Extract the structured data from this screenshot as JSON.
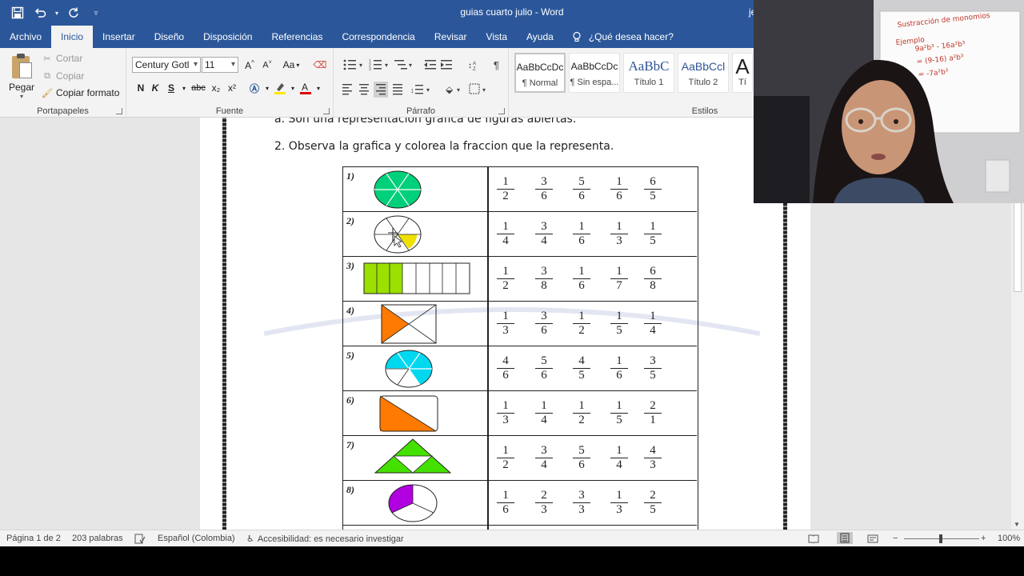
{
  "window": {
    "doc_title": "guias cuarto julio  -  Word",
    "user_fragment": "je"
  },
  "tabs": [
    "Archivo",
    "Inicio",
    "Insertar",
    "Diseño",
    "Disposición",
    "Referencias",
    "Correspondencia",
    "Revisar",
    "Vista",
    "Ayuda"
  ],
  "tell_me": "¿Qué desea hacer?",
  "clipboard": {
    "paste": "Pegar",
    "cut": "Cortar",
    "copy": "Copiar",
    "format_painter": "Copiar formato",
    "label": "Portapapeles"
  },
  "font": {
    "name": "Century Gotl",
    "size": "11",
    "label": "Fuente",
    "bold": "N",
    "italic": "K",
    "underline": "S",
    "strike": "abc",
    "subscript": "x₂",
    "superscript": "x²",
    "grow": "A^",
    "shrink": "A˅",
    "case": "Aa"
  },
  "paragraph": {
    "label": "Párrafo"
  },
  "styles": {
    "label": "Estilos",
    "items": [
      {
        "preview": "AaBbCcDc",
        "name": "¶ Normal"
      },
      {
        "preview": "AaBbCcDc",
        "name": "¶ Sin espa..."
      },
      {
        "preview": "AaBbC",
        "name": "Título 1"
      },
      {
        "preview": "AaBbCcl",
        "name": "Título 2"
      },
      {
        "preview": "A",
        "name": "Tí"
      }
    ]
  },
  "document": {
    "line_a": "a.   Son una representación gráfica de figuras abiertas.",
    "line_2": "2.   Observa la grafica y colorea la fraccion que la representa."
  },
  "worksheet": {
    "rows": [
      {
        "num": "1)",
        "fractions": [
          [
            "1",
            "2"
          ],
          [
            "3",
            "6"
          ],
          [
            "5",
            "6"
          ],
          [
            "1",
            "6"
          ],
          [
            "6",
            "5"
          ]
        ]
      },
      {
        "num": "2)",
        "fractions": [
          [
            "1",
            "4"
          ],
          [
            "3",
            "4"
          ],
          [
            "1",
            "6"
          ],
          [
            "1",
            "3"
          ],
          [
            "1",
            "5"
          ]
        ]
      },
      {
        "num": "3)",
        "fractions": [
          [
            "1",
            "2"
          ],
          [
            "3",
            "8"
          ],
          [
            "1",
            "6"
          ],
          [
            "1",
            "7"
          ],
          [
            "6",
            "8"
          ]
        ]
      },
      {
        "num": "4)",
        "fractions": [
          [
            "1",
            "3"
          ],
          [
            "3",
            "6"
          ],
          [
            "1",
            "2"
          ],
          [
            "1",
            "5"
          ],
          [
            "1",
            "4"
          ]
        ]
      },
      {
        "num": "5)",
        "fractions": [
          [
            "4",
            "6"
          ],
          [
            "5",
            "6"
          ],
          [
            "4",
            "5"
          ],
          [
            "1",
            "6"
          ],
          [
            "3",
            "5"
          ]
        ]
      },
      {
        "num": "6)",
        "fractions": [
          [
            "1",
            "3"
          ],
          [
            "1",
            "4"
          ],
          [
            "1",
            "2"
          ],
          [
            "1",
            "5"
          ],
          [
            "2",
            "1"
          ]
        ]
      },
      {
        "num": "7)",
        "fractions": [
          [
            "1",
            "2"
          ],
          [
            "3",
            "4"
          ],
          [
            "5",
            "6"
          ],
          [
            "1",
            "4"
          ],
          [
            "4",
            "3"
          ]
        ]
      },
      {
        "num": "8)",
        "fractions": [
          [
            "1",
            "6"
          ],
          [
            "2",
            "3"
          ],
          [
            "3",
            "3"
          ],
          [
            "1",
            "3"
          ],
          [
            "2",
            "5"
          ]
        ]
      }
    ],
    "colors": {
      "green": "#00d07a",
      "yellow": "#f0e000",
      "lime": "#9be000",
      "orange": "#ff7a00",
      "cyan": "#00d8f0",
      "bright_green": "#44e000",
      "purple": "#b000e0"
    }
  },
  "status": {
    "page": "Página 1 de 2",
    "words": "203 palabras",
    "language": "Español (Colombia)",
    "accessibility": "Accesibilidad: es necesario investigar",
    "zoom": "100%",
    "zoom_level": 1.0
  },
  "webcam": {
    "board_title": "Sustracción de monomios",
    "board_example": "Ejemplo",
    "board_line1": "9a²b³ - 16a²b³",
    "board_line2": "= (9-16) a²b³",
    "board_line3": "= -7a²b³"
  }
}
